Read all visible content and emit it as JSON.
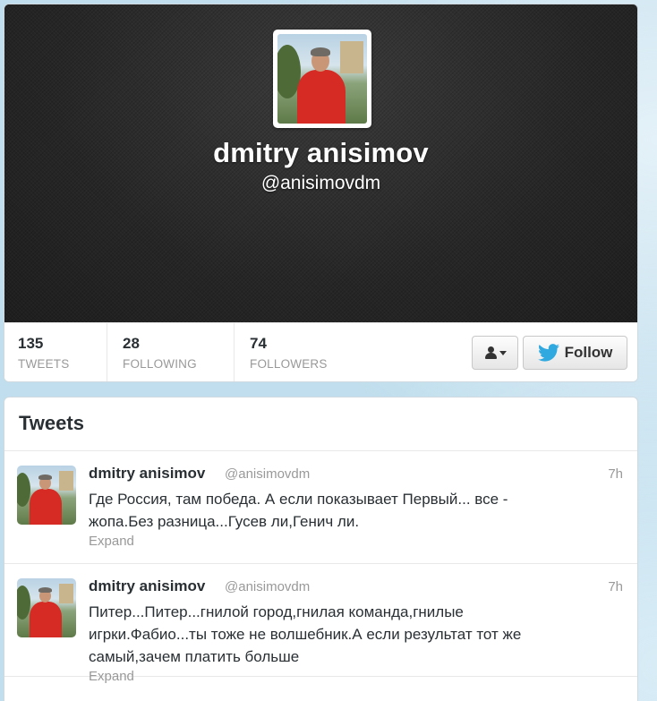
{
  "profile": {
    "name": "dmitry anisimov",
    "handle": "@anisimovdm",
    "stats": [
      {
        "value": "135",
        "label": "TWEETS"
      },
      {
        "value": "28",
        "label": "FOLLOWING"
      },
      {
        "value": "74",
        "label": "FOLLOWERS"
      }
    ],
    "follow_label": "Follow",
    "user_menu_icon": "user-dropdown-icon",
    "follow_icon": "twitter-bird-icon"
  },
  "tweets": {
    "title": "Tweets",
    "items": [
      {
        "name": "dmitry anisimov",
        "handle": "@anisimovdm",
        "time": "7h",
        "text": "Где Россия, там победа. А если показывает Первый... все - жопа.Без разница...Гусев ли,Генич ли.",
        "expand": "Expand"
      },
      {
        "name": "dmitry anisimov",
        "handle": "@anisimovdm",
        "time": "7h",
        "text": "Питер...Питер...гнилой город,гнилая команда,гнилые игрки.Фабио...ты тоже не волшебник.А если результат тот же самый,зачем платить больше",
        "expand": "Expand"
      }
    ]
  },
  "colors": {
    "page_bg": "#c0deed",
    "header_bg": "#2a2a2a",
    "twitter_blue": "#2fa9e0",
    "muted_text": "#999999"
  }
}
